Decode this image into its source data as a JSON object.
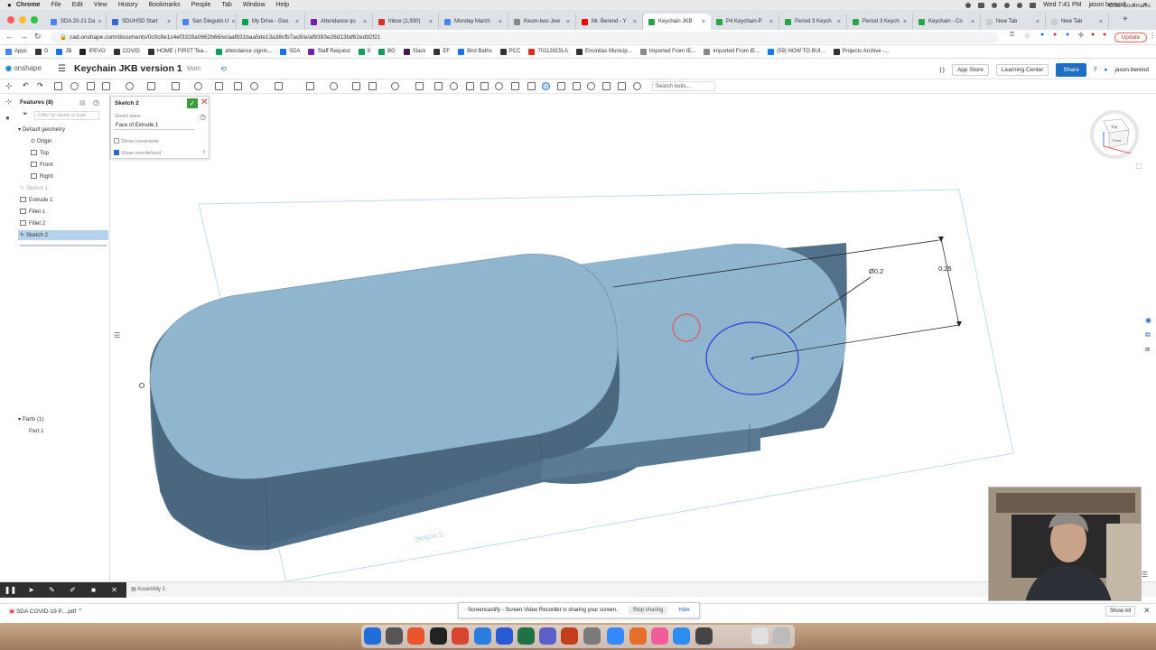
{
  "macbar": {
    "menus": [
      "Chrome",
      "File",
      "Edit",
      "View",
      "History",
      "Bookmarks",
      "People",
      "Tab",
      "Window",
      "Help"
    ],
    "clock": "Wed 7:41 PM",
    "user": "jason berend"
  },
  "browser_tabs": [
    {
      "label": "SDA 20-21 Da",
      "color": "#4a86e8"
    },
    {
      "label": "SDUHSD Start",
      "color": "#3367d6"
    },
    {
      "label": "San Dieguito U",
      "color": "#4a86e8"
    },
    {
      "label": "My Drive - Goo",
      "color": "#0f9d58"
    },
    {
      "label": "Attendance qu",
      "color": "#7b1fa2"
    },
    {
      "label": "Inbox (1,930)",
      "color": "#d93025"
    },
    {
      "label": "Monday March",
      "color": "#4a86e8"
    },
    {
      "label": "Keum-boo Jew",
      "color": "#888888"
    },
    {
      "label": "Mr. Berend - Y",
      "color": "#ff0000"
    },
    {
      "label": "Keychain JKB",
      "color": "#2ca24a",
      "active": true
    },
    {
      "label": "P4 Keychain-P",
      "color": "#2ca24a"
    },
    {
      "label": "Period 3 Keych",
      "color": "#2ca24a"
    },
    {
      "label": "Period 3 Keych",
      "color": "#2ca24a"
    },
    {
      "label": "Keychain - Co",
      "color": "#2ca24a"
    },
    {
      "label": "New Tab",
      "color": "#cccccc"
    },
    {
      "label": "New Tab",
      "color": "#cccccc"
    }
  ],
  "address_bar": {
    "url": "cad.onshape.com/documents/0c0c8e1c4ef3328a0662b66/w/aaf831baa5de13a38cfb7ac8/e/af9393e28d13faf62ed92f21",
    "update_label": "Update"
  },
  "bookmarks": [
    {
      "label": "Apps",
      "color": "#4285f4"
    },
    {
      "label": "G",
      "color": "#333333"
    },
    {
      "label": "JB",
      "color": "#1a73e8"
    },
    {
      "label": "IPEVO",
      "color": "#222222"
    },
    {
      "label": "COVID",
      "color": "#333333"
    },
    {
      "label": "HOME | FIRST Tea...",
      "color": "#333333"
    },
    {
      "label": "attendance signin...",
      "color": "#0f9d58"
    },
    {
      "label": "SDA",
      "color": "#1a73e8"
    },
    {
      "label": "Staff Request",
      "color": "#7b1fa2"
    },
    {
      "label": "8",
      "color": "#0f9d58"
    },
    {
      "label": "BG",
      "color": "#0f9d58"
    },
    {
      "label": "Slack",
      "color": "#4a154b"
    },
    {
      "label": "EF",
      "color": "#333333"
    },
    {
      "label": "Bird Baths",
      "color": "#1a73e8"
    },
    {
      "label": "PCC",
      "color": "#333333"
    },
    {
      "label": "70112815LA",
      "color": "#d93025"
    },
    {
      "label": "Encinitas Municip...",
      "color": "#333333"
    },
    {
      "label": "Imported From IE...",
      "color": "#888888"
    },
    {
      "label": "Imported From IE...",
      "color": "#888888"
    },
    {
      "label": "(59) HOW TO BUI...",
      "color": "#1877f2"
    },
    {
      "label": "Projects Archive -...",
      "color": "#333333"
    }
  ],
  "bookmarks_other": "Other Bookmarks",
  "onshape": {
    "logo": "onshape",
    "document_title": "Keychain JKB version 1",
    "branch": "Main",
    "app_store": "App Store",
    "learning_center": "Learning Center",
    "share": "Share",
    "user": "jason berend"
  },
  "toolbar": {
    "search_placeholder": "Search tools..."
  },
  "features_panel": {
    "title": "Features (8)",
    "filter_placeholder": "Filter by name or type",
    "items": [
      {
        "label": "Default geometry"
      },
      {
        "label": "Origin"
      },
      {
        "label": "Top"
      },
      {
        "label": "Front"
      },
      {
        "label": "Right"
      },
      {
        "label": "Sketch 1"
      },
      {
        "label": "Extrude 1"
      },
      {
        "label": "Fillet 1"
      },
      {
        "label": "Fillet 2"
      },
      {
        "label": "Sketch 2"
      }
    ],
    "parts_header": "Parts (1)",
    "parts": [
      "Part 1"
    ]
  },
  "sketch_dialog": {
    "title": "Sketch 2",
    "plane_label": "Sketch plane",
    "plane_value": "Face of Extrude 1",
    "show_constraints": "Show constraints",
    "show_overdefined": "Show overdefined"
  },
  "viewport": {
    "dimension_diameter": "Ø0.2",
    "dimension_distance": "0.25",
    "sketch_watermark": "Sketch 2",
    "viewcube_top": "Top",
    "viewcube_front": "Front",
    "model_color": "#8fb5cf",
    "sketch_color": "#2a3ed8"
  },
  "bottom_bar": {
    "assembly_tab": "Assembly 1"
  },
  "share_notice": {
    "message": "Screencastify - Screen Video Recorder is sharing your screen.",
    "stop": "Stop sharing",
    "hide": "Hide"
  },
  "downloads": {
    "file": "SDA COVID-19 P....pdf",
    "show_all": "Show All"
  }
}
